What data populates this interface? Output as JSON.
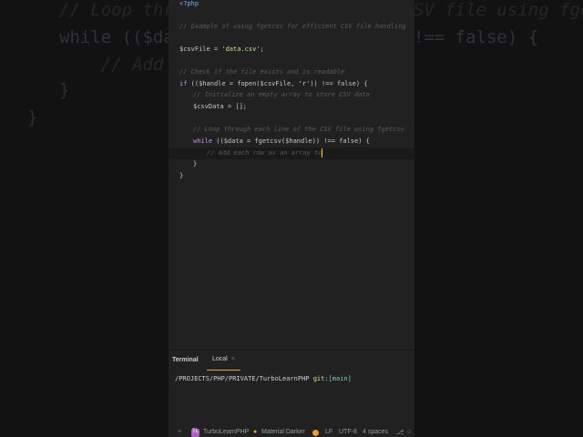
{
  "background_code": [
    "// Loop through each line of the CSV file using fgetcsv",
    "while (($data = fgetcsv($handle)) !== false) {",
    "    // Add each row as an array to",
    "}",
    "}"
  ],
  "editor": {
    "lines": [
      {
        "text": "<?php",
        "type": "tag"
      },
      {
        "text": "// Example of using fgetcsv for efficient CSV file handling",
        "type": "cm"
      },
      {
        "pre": "$csvFile = ",
        "str": "'data.csv'",
        "post": ";"
      },
      {
        "text": "// Check if the file exists and is readable",
        "type": "cm"
      },
      {
        "kw": "if",
        "post": " (($handle = fopen($csvFile, ",
        "str": "'r'",
        "post2": ")) !== false) {"
      },
      {
        "text": "// Initialize an empty array to store CSV data",
        "type": "cm"
      },
      {
        "text": "$csvData = [];",
        "type": "code"
      },
      {
        "text": "// Loop through each line of the CSV file using fgetcsv",
        "type": "cm"
      },
      {
        "kw": "while",
        "post": " (($data = fgetcsv($handle)) !== false) {"
      },
      {
        "text": "// Add each row as an array to",
        "type": "cm"
      },
      {
        "text": "}",
        "type": "code"
      },
      {
        "text": "}",
        "type": "code"
      }
    ]
  },
  "terminal": {
    "title": "Terminal",
    "tab": "Local",
    "close": "×",
    "path": "/PROJECTS/PHP/PRIVATE/TurboLearnPHP ",
    "git": "git:",
    "branch": "[main]"
  },
  "statusbar": {
    "project_badge": "TL",
    "project": "TurboLearnPHP",
    "theme": "Material Darker",
    "line_ending": "LF",
    "encoding": "UTF-8",
    "indent": "4 spaces"
  }
}
